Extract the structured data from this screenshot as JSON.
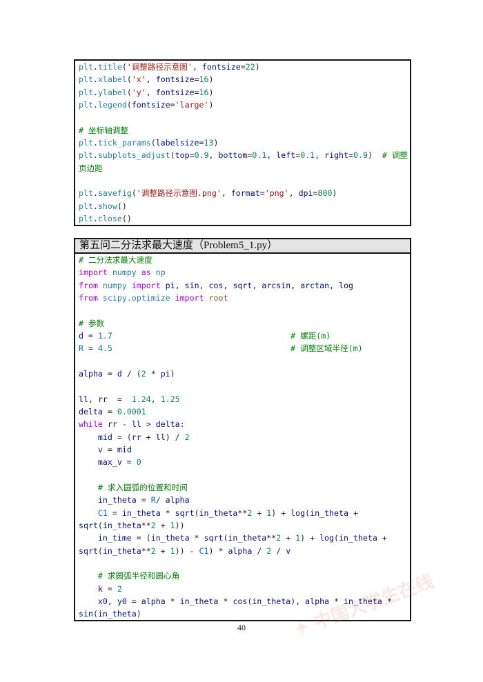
{
  "block1": {
    "lines": [
      [
        [
          "p",
          "plt"
        ],
        [
          "o",
          "."
        ],
        [
          "p",
          "title"
        ],
        [
          "o",
          "("
        ],
        [
          "s",
          "'调整路径示意图'"
        ],
        [
          "o",
          ", "
        ],
        [
          "n",
          "fontsize"
        ],
        [
          "o",
          "="
        ],
        [
          "d",
          "22"
        ],
        [
          "o",
          ")"
        ]
      ],
      [
        [
          "p",
          "plt"
        ],
        [
          "o",
          "."
        ],
        [
          "p",
          "xlabel"
        ],
        [
          "o",
          "("
        ],
        [
          "s",
          "'x'"
        ],
        [
          "o",
          ", "
        ],
        [
          "n",
          "fontsize"
        ],
        [
          "o",
          "="
        ],
        [
          "d",
          "16"
        ],
        [
          "o",
          ")"
        ]
      ],
      [
        [
          "p",
          "plt"
        ],
        [
          "o",
          "."
        ],
        [
          "p",
          "ylabel"
        ],
        [
          "o",
          "("
        ],
        [
          "s",
          "'y'"
        ],
        [
          "o",
          ", "
        ],
        [
          "n",
          "fontsize"
        ],
        [
          "o",
          "="
        ],
        [
          "d",
          "16"
        ],
        [
          "o",
          ")"
        ]
      ],
      [
        [
          "p",
          "plt"
        ],
        [
          "o",
          "."
        ],
        [
          "p",
          "legend"
        ],
        [
          "o",
          "("
        ],
        [
          "n",
          "fontsize"
        ],
        [
          "o",
          "="
        ],
        [
          "s",
          "'large'"
        ],
        [
          "o",
          ")"
        ]
      ],
      [],
      [
        [
          "c",
          "# 坐标轴调整"
        ]
      ],
      [
        [
          "p",
          "plt"
        ],
        [
          "o",
          "."
        ],
        [
          "p",
          "tick_params"
        ],
        [
          "o",
          "("
        ],
        [
          "n",
          "labelsize"
        ],
        [
          "o",
          "="
        ],
        [
          "d",
          "13"
        ],
        [
          "o",
          ")"
        ]
      ],
      [
        [
          "p",
          "plt"
        ],
        [
          "o",
          "."
        ],
        [
          "p",
          "subplots_adjust"
        ],
        [
          "o",
          "("
        ],
        [
          "n",
          "top"
        ],
        [
          "o",
          "="
        ],
        [
          "d",
          "0.9"
        ],
        [
          "o",
          ", "
        ],
        [
          "n",
          "bottom"
        ],
        [
          "o",
          "="
        ],
        [
          "d",
          "0.1"
        ],
        [
          "o",
          ", "
        ],
        [
          "n",
          "left"
        ],
        [
          "o",
          "="
        ],
        [
          "d",
          "0.1"
        ],
        [
          "o",
          ", "
        ],
        [
          "n",
          "right"
        ],
        [
          "o",
          "="
        ],
        [
          "d",
          "0.9"
        ],
        [
          "o",
          ")  "
        ],
        [
          "c",
          "# 调整"
        ]
      ],
      [
        [
          "c",
          "页边距"
        ]
      ],
      [],
      [
        [
          "p",
          "plt"
        ],
        [
          "o",
          "."
        ],
        [
          "p",
          "savefig"
        ],
        [
          "o",
          "("
        ],
        [
          "s",
          "'调整路径示意图.png'"
        ],
        [
          "o",
          ", "
        ],
        [
          "n",
          "format"
        ],
        [
          "o",
          "="
        ],
        [
          "s",
          "'png'"
        ],
        [
          "o",
          ", "
        ],
        [
          "n",
          "dpi"
        ],
        [
          "o",
          "="
        ],
        [
          "d",
          "800"
        ],
        [
          "o",
          ")"
        ]
      ],
      [
        [
          "p",
          "plt"
        ],
        [
          "o",
          "."
        ],
        [
          "p",
          "show"
        ],
        [
          "o",
          "()"
        ]
      ],
      [
        [
          "p",
          "plt"
        ],
        [
          "o",
          "."
        ],
        [
          "p",
          "close"
        ],
        [
          "o",
          "()"
        ]
      ]
    ]
  },
  "block2": {
    "title": "第五问二分法求最大速度（Problem5_1.py）",
    "lines": [
      [
        [
          "c",
          "# 二分法求最大速度"
        ]
      ],
      [
        [
          "k",
          "import"
        ],
        [
          "o",
          " "
        ],
        [
          "m",
          "numpy"
        ],
        [
          "o",
          " "
        ],
        [
          "k",
          "as"
        ],
        [
          "o",
          " "
        ],
        [
          "m",
          "np"
        ]
      ],
      [
        [
          "k",
          "from"
        ],
        [
          "o",
          " "
        ],
        [
          "m",
          "numpy"
        ],
        [
          "o",
          " "
        ],
        [
          "k",
          "import"
        ],
        [
          "o",
          " "
        ],
        [
          "n",
          "pi"
        ],
        [
          "o",
          ", "
        ],
        [
          "n",
          "sin"
        ],
        [
          "o",
          ", "
        ],
        [
          "n",
          "cos"
        ],
        [
          "o",
          ", "
        ],
        [
          "n",
          "sqrt"
        ],
        [
          "o",
          ", "
        ],
        [
          "n",
          "arcsin"
        ],
        [
          "o",
          ", "
        ],
        [
          "n",
          "arctan"
        ],
        [
          "o",
          ", "
        ],
        [
          "n",
          "log"
        ]
      ],
      [
        [
          "k",
          "from"
        ],
        [
          "o",
          " "
        ],
        [
          "m",
          "scipy.optimize"
        ],
        [
          "o",
          " "
        ],
        [
          "k",
          "import"
        ],
        [
          "o",
          " "
        ],
        [
          "f",
          "root"
        ]
      ],
      [],
      [
        [
          "c",
          "# 参数"
        ]
      ],
      [
        [
          "n",
          "d"
        ],
        [
          "o",
          " = "
        ],
        [
          "d",
          "1.7"
        ],
        [
          "o",
          "                                     "
        ],
        [
          "c",
          "# 螺距(m)"
        ]
      ],
      [
        [
          "b",
          "R"
        ],
        [
          "o",
          " = "
        ],
        [
          "d",
          "4.5"
        ],
        [
          "o",
          "                                     "
        ],
        [
          "c",
          "# 调整区域半径(m)"
        ]
      ],
      [],
      [
        [
          "n",
          "alpha"
        ],
        [
          "o",
          " = "
        ],
        [
          "n",
          "d"
        ],
        [
          "o",
          " / ("
        ],
        [
          "d",
          "2"
        ],
        [
          "o",
          " * "
        ],
        [
          "n",
          "pi"
        ],
        [
          "o",
          ")"
        ]
      ],
      [],
      [
        [
          "n",
          "ll"
        ],
        [
          "o",
          ", "
        ],
        [
          "n",
          "rr"
        ],
        [
          "o",
          "  =  "
        ],
        [
          "d",
          "1.24"
        ],
        [
          "o",
          ", "
        ],
        [
          "d",
          "1.25"
        ]
      ],
      [
        [
          "n",
          "delta"
        ],
        [
          "o",
          " = "
        ],
        [
          "d",
          "0.0001"
        ]
      ],
      [
        [
          "k",
          "while"
        ],
        [
          "o",
          " "
        ],
        [
          "n",
          "rr"
        ],
        [
          "o",
          " - "
        ],
        [
          "n",
          "ll"
        ],
        [
          "o",
          " > "
        ],
        [
          "n",
          "delta"
        ],
        [
          "o",
          ":"
        ]
      ],
      [
        [
          "o",
          "    "
        ],
        [
          "n",
          "mid"
        ],
        [
          "o",
          " = ("
        ],
        [
          "n",
          "rr"
        ],
        [
          "o",
          " + "
        ],
        [
          "n",
          "ll"
        ],
        [
          "o",
          ") / "
        ],
        [
          "d",
          "2"
        ]
      ],
      [
        [
          "o",
          "    "
        ],
        [
          "n",
          "v"
        ],
        [
          "o",
          " = "
        ],
        [
          "n",
          "mid"
        ]
      ],
      [
        [
          "o",
          "    "
        ],
        [
          "n",
          "max_v"
        ],
        [
          "o",
          " = "
        ],
        [
          "d",
          "0"
        ]
      ],
      [],
      [
        [
          "o",
          "    "
        ],
        [
          "c",
          "# 求入圆弧的位置和时间"
        ]
      ],
      [
        [
          "o",
          "    "
        ],
        [
          "n",
          "in_theta"
        ],
        [
          "o",
          " = "
        ],
        [
          "b",
          "R"
        ],
        [
          "o",
          "/ "
        ],
        [
          "n",
          "alpha"
        ]
      ],
      [
        [
          "o",
          "    "
        ],
        [
          "b",
          "C1"
        ],
        [
          "o",
          " = "
        ],
        [
          "n",
          "in_theta"
        ],
        [
          "o",
          " * "
        ],
        [
          "n",
          "sqrt"
        ],
        [
          "o",
          "("
        ],
        [
          "n",
          "in_theta"
        ],
        [
          "o",
          "**"
        ],
        [
          "d",
          "2"
        ],
        [
          "o",
          " + "
        ],
        [
          "d",
          "1"
        ],
        [
          "o",
          ") + "
        ],
        [
          "n",
          "log"
        ],
        [
          "o",
          "("
        ],
        [
          "n",
          "in_theta"
        ],
        [
          "o",
          " +"
        ]
      ],
      [
        [
          "n",
          "sqrt"
        ],
        [
          "o",
          "("
        ],
        [
          "n",
          "in_theta"
        ],
        [
          "o",
          "**"
        ],
        [
          "d",
          "2"
        ],
        [
          "o",
          " + "
        ],
        [
          "d",
          "1"
        ],
        [
          "o",
          "))"
        ]
      ],
      [
        [
          "o",
          "    "
        ],
        [
          "n",
          "in_time"
        ],
        [
          "o",
          " = ("
        ],
        [
          "n",
          "in_theta"
        ],
        [
          "o",
          " * "
        ],
        [
          "n",
          "sqrt"
        ],
        [
          "o",
          "("
        ],
        [
          "n",
          "in_theta"
        ],
        [
          "o",
          "**"
        ],
        [
          "d",
          "2"
        ],
        [
          "o",
          " + "
        ],
        [
          "d",
          "1"
        ],
        [
          "o",
          ") + "
        ],
        [
          "n",
          "log"
        ],
        [
          "o",
          "("
        ],
        [
          "n",
          "in_theta"
        ],
        [
          "o",
          " +"
        ]
      ],
      [
        [
          "n",
          "sqrt"
        ],
        [
          "o",
          "("
        ],
        [
          "n",
          "in_theta"
        ],
        [
          "o",
          "**"
        ],
        [
          "d",
          "2"
        ],
        [
          "o",
          " + "
        ],
        [
          "d",
          "1"
        ],
        [
          "o",
          ")) - "
        ],
        [
          "b",
          "C1"
        ],
        [
          "o",
          ") * "
        ],
        [
          "n",
          "alpha"
        ],
        [
          "o",
          " / "
        ],
        [
          "d",
          "2"
        ],
        [
          "o",
          " / "
        ],
        [
          "n",
          "v"
        ]
      ],
      [],
      [
        [
          "o",
          "    "
        ],
        [
          "c",
          "# 求圆弧半径和圆心角"
        ]
      ],
      [
        [
          "o",
          "    "
        ],
        [
          "n",
          "k"
        ],
        [
          "o",
          " = "
        ],
        [
          "d",
          "2"
        ]
      ],
      [
        [
          "o",
          "    "
        ],
        [
          "n",
          "x0"
        ],
        [
          "o",
          ", "
        ],
        [
          "n",
          "y0"
        ],
        [
          "o",
          " = "
        ],
        [
          "n",
          "alpha"
        ],
        [
          "o",
          " * "
        ],
        [
          "n",
          "in_theta"
        ],
        [
          "o",
          " * "
        ],
        [
          "n",
          "cos"
        ],
        [
          "o",
          "("
        ],
        [
          "n",
          "in_theta"
        ],
        [
          "o",
          "), "
        ],
        [
          "n",
          "alpha"
        ],
        [
          "o",
          " * "
        ],
        [
          "n",
          "in_theta"
        ],
        [
          "o",
          " *"
        ]
      ],
      [
        [
          "n",
          "sin"
        ],
        [
          "o",
          "("
        ],
        [
          "n",
          "in_theta"
        ],
        [
          "o",
          ")"
        ]
      ]
    ]
  },
  "page_number": "40",
  "watermark": "中国大学生在线"
}
